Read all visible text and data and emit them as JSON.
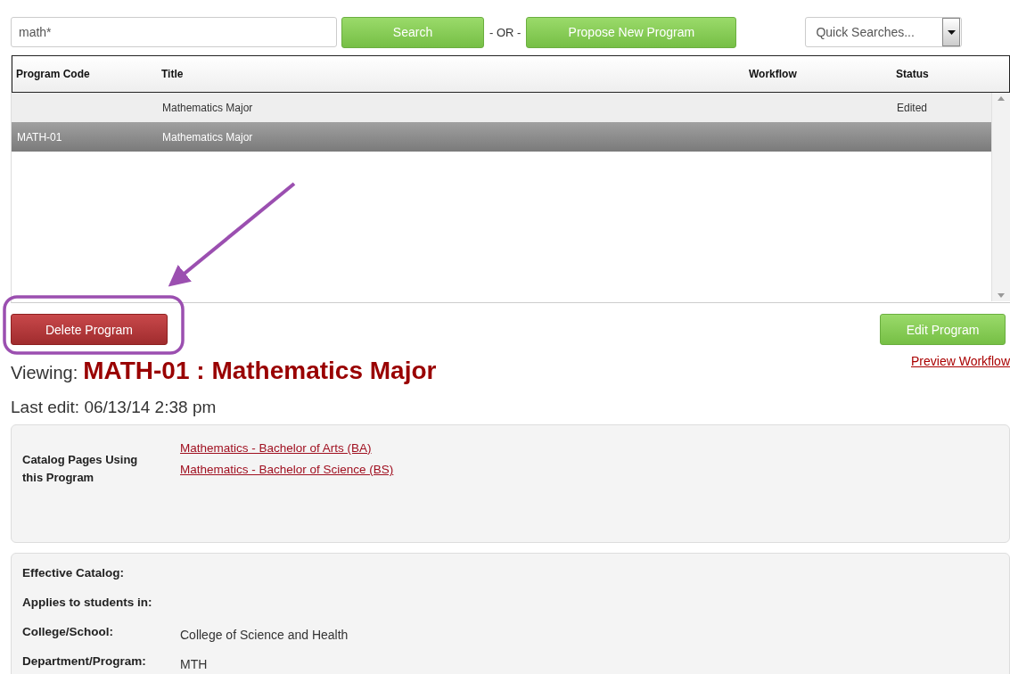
{
  "search": {
    "value": "math*",
    "button": "Search",
    "separator": "- OR -",
    "propose_button": "Propose New Program",
    "quick_searches": {
      "placeholder": "Quick Searches..."
    }
  },
  "table": {
    "columns": [
      "Program Code",
      "Title",
      "Workflow",
      "Status"
    ],
    "rows": [
      {
        "title": "Mathematics Major",
        "status": "Edited",
        "selected": false
      },
      {
        "code": "MATH-01",
        "title": "Mathematics Major",
        "selected": true
      }
    ]
  },
  "actions": {
    "delete_button": "Delete Program",
    "edit_button": "Edit Program",
    "preview_link": "Preview Workflow"
  },
  "viewing": {
    "label": "Viewing:",
    "title": "MATH-01 : Mathematics Major"
  },
  "last_edit": "Last edit: 06/13/14 2:38 pm",
  "catalog_pages": {
    "label": "Catalog Pages Using this Program",
    "links": [
      "Mathematics - Bachelor of Arts (BA)",
      "Mathematics - Bachelor of Science (BS)"
    ]
  },
  "details": [
    {
      "label": "Effective Catalog:"
    },
    {
      "label": "Applies to students in:"
    },
    {
      "label": "College/School:",
      "value": "College of Science and Health"
    },
    {
      "label": "Department/Program:",
      "value": "MTH"
    }
  ]
}
